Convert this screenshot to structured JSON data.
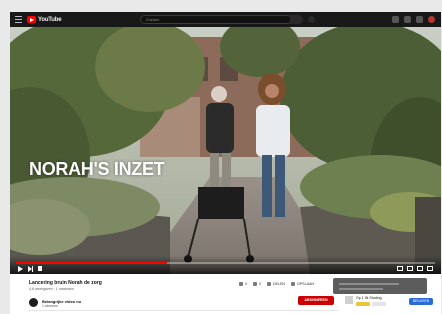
{
  "app": {
    "logo_text": "YouTube",
    "search_placeholder": "Zoeken"
  },
  "video": {
    "overlay_title": "NORAH'S INZET",
    "progress_fraction": 0.36
  },
  "details": {
    "title": "Lancering bruin Norah de zorg",
    "meta": "4,6 weergaven · 1 maanden",
    "actions": [
      {
        "label": "0"
      },
      {
        "label": "0"
      },
      {
        "label": "DELEN"
      },
      {
        "label": "OPSLAAN"
      }
    ],
    "channel_name": "Belangrijke video nu",
    "channel_subs": "1 abonnee",
    "subscribe_label": "ABONNEREN",
    "up_next_title": "Op 1 IN Studing",
    "up_next_button": "BEKIJKEN"
  },
  "colors": {
    "accent": "#ff0000",
    "topbar": "#181818",
    "subscribe": "#cc0000"
  }
}
